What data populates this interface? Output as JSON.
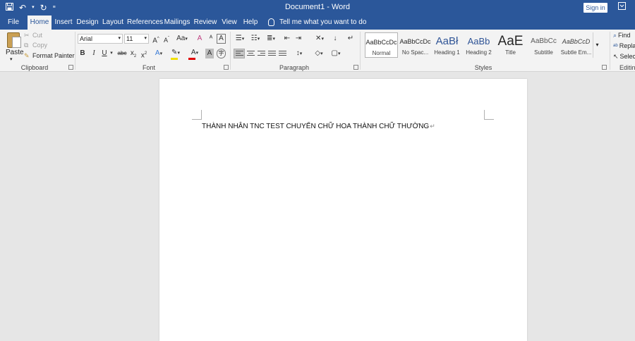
{
  "title_bar": {
    "document_title": "Document1 - Word",
    "sign_in_label": "Sign in",
    "qat_icons": [
      "save-icon",
      "undo-icon",
      "redo-icon",
      "customize-qat-icon"
    ]
  },
  "tabs": [
    {
      "label": "File",
      "active": false
    },
    {
      "label": "Home",
      "active": true
    },
    {
      "label": "Insert",
      "active": false
    },
    {
      "label": "Design",
      "active": false
    },
    {
      "label": "Layout",
      "active": false
    },
    {
      "label": "References",
      "active": false
    },
    {
      "label": "Mailings",
      "active": false
    },
    {
      "label": "Review",
      "active": false
    },
    {
      "label": "View",
      "active": false
    },
    {
      "label": "Help",
      "active": false
    }
  ],
  "tell_me": "Tell me what you want to do",
  "clipboard": {
    "group_label": "Clipboard",
    "paste_label": "Paste",
    "cut_label": "Cut",
    "copy_label": "Copy",
    "format_painter_label": "Format Painter"
  },
  "font": {
    "group_label": "Font",
    "font_name": "Arial",
    "font_size": "11",
    "grow_label": "A",
    "shrink_label": "A",
    "change_case_label": "Aa",
    "bold_label": "B",
    "italic_label": "I",
    "underline_label": "U",
    "strike_label": "abc",
    "subscript_label": "x",
    "superscript_label": "x",
    "font_color_label": "A",
    "char_shading_label": "A"
  },
  "paragraph": {
    "group_label": "Paragraph"
  },
  "styles": {
    "group_label": "Styles",
    "items": [
      {
        "sample": "AaBbCcDc",
        "name": "Normal"
      },
      {
        "sample": "AaBbCcDc",
        "name": "No Spac..."
      },
      {
        "sample": "AaBł",
        "name": "Heading 1"
      },
      {
        "sample": "AaBb",
        "name": "Heading 2"
      },
      {
        "sample": "AaE",
        "name": "Title"
      },
      {
        "sample": "AaBbCc",
        "name": "Subtitle"
      },
      {
        "sample": "AaBbCcD",
        "name": "Subtle Em..."
      }
    ]
  },
  "editing": {
    "group_label": "Editing",
    "find_label": "Find",
    "replace_label": "Repla",
    "select_label": "Selec"
  },
  "document": {
    "body_text": "THÀNH NHÂN TNC TEST CHUYỂN CHỮ HOA THÀNH CHỮ THƯỜNG",
    "paragraph_mark": "↵"
  },
  "colors": {
    "accent": "#2b579a",
    "ribbon_bg": "#f3f3f3",
    "canvas_bg": "#e6e6e6",
    "font_color_bar": "#e00000",
    "highlight_bar": "#f0e000"
  }
}
